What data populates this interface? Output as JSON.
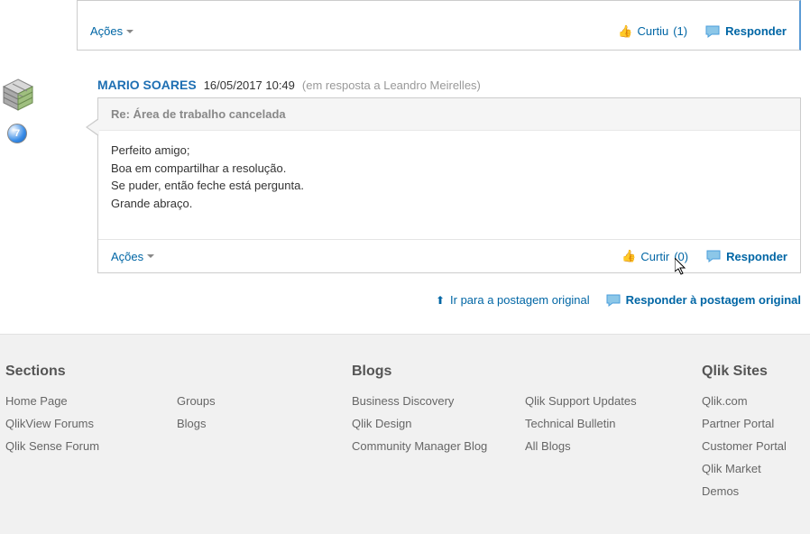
{
  "post_bar": {
    "actions_label": "Ações",
    "like_label": "Curtiu",
    "like_count": "(1)",
    "reply_label": "Responder"
  },
  "reply": {
    "author": "MARIO SOARES",
    "timestamp": "16/05/2017 10:49",
    "in_reply_to": "(em resposta a Leandro Meirelles)",
    "title": "Re: Área de trabalho cancelada",
    "body_lines": [
      "Perfeito amigo;",
      "Boa em compartilhar a resolução.",
      "Se puder, então feche está pergunta.",
      "Grande abraço."
    ],
    "level_badge": "7",
    "footer": {
      "actions_label": "Ações",
      "like_label": "Curtir",
      "like_count": "(0)",
      "reply_label": "Responder"
    }
  },
  "thread_footer": {
    "go_original": "Ir para a postagem original",
    "respond_original": "Responder à postagem original"
  },
  "footer": {
    "sections_heading": "Sections",
    "sections_col1": [
      "Home Page",
      "QlikView Forums",
      "Qlik Sense Forum"
    ],
    "sections_col2": [
      "Groups",
      "Blogs"
    ],
    "blogs_heading": "Blogs",
    "blogs_col1": [
      "Business Discovery",
      "Qlik Design",
      "Community Manager Blog"
    ],
    "blogs_col2": [
      "Qlik Support Updates",
      "Technical Bulletin",
      "All Blogs"
    ],
    "qliksites_heading": "Qlik Sites",
    "qliksites_col": [
      "Qlik.com",
      "Partner Portal",
      "Customer Portal",
      "Qlik Market",
      "Demos"
    ]
  }
}
